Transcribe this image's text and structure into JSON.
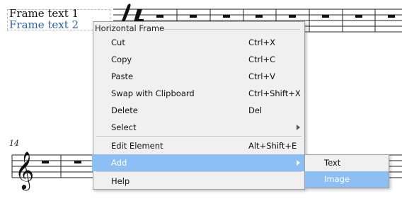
{
  "score": {
    "frame_text_1": "Frame text 1",
    "frame_text_2": "Frame text 2",
    "measure_number": "14"
  },
  "context_menu": {
    "title": "Horizontal Frame",
    "items": [
      {
        "label": "Cut",
        "shortcut": "Ctrl+X"
      },
      {
        "label": "Copy",
        "shortcut": "Ctrl+C"
      },
      {
        "label": "Paste",
        "shortcut": "Ctrl+V"
      },
      {
        "label": "Swap with Clipboard",
        "shortcut": "Ctrl+Shift+X"
      },
      {
        "label": "Delete",
        "shortcut": "Del"
      },
      {
        "label": "Select",
        "shortcut": ""
      },
      {
        "label": "Edit Element",
        "shortcut": "Alt+Shift+E"
      },
      {
        "label": "Add",
        "shortcut": ""
      },
      {
        "label": "Help",
        "shortcut": ""
      }
    ],
    "highlight_color": "#8dbef4"
  },
  "add_submenu": {
    "items": [
      {
        "label": "Text"
      },
      {
        "label": "Image"
      }
    ]
  }
}
